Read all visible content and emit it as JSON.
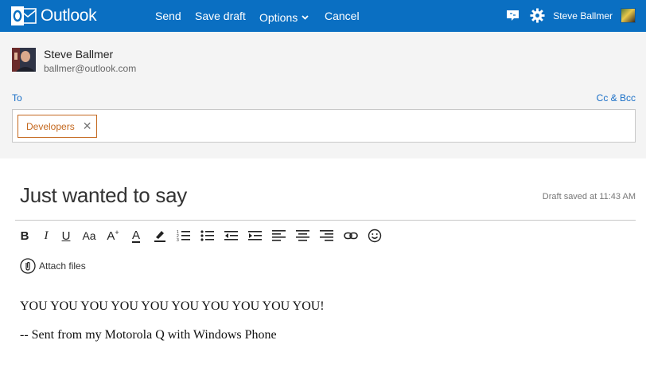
{
  "topbar": {
    "app_name": "Outlook",
    "send_label": "Send",
    "save_draft_label": "Save draft",
    "options_label": "Options",
    "cancel_label": "Cancel",
    "user_name": "Steve Ballmer",
    "icons": [
      "outlook-logo-icon",
      "chat-icon",
      "settings-gear-icon"
    ],
    "bg_color": "#0a6fc2"
  },
  "sender": {
    "name": "Steve Ballmer",
    "email": "ballmer@outlook.com"
  },
  "recipients": {
    "to_label": "To",
    "cc_bcc_label": "Cc & Bcc",
    "chips": [
      {
        "label": "Developers"
      }
    ],
    "chip_color": "#c4681e"
  },
  "compose": {
    "subject": "Just wanted to say",
    "draft_status": "Draft saved at 11:43 AM",
    "toolbar": [
      "bold",
      "italic",
      "underline",
      "font-size",
      "grow-font",
      "font-color",
      "highlight",
      "numbered-list",
      "bulleted-list",
      "decrease-indent",
      "increase-indent",
      "align-left",
      "align-center",
      "align-right",
      "insert-link",
      "emoticon"
    ],
    "toolbar_labels": {
      "bold": "B",
      "italic": "I",
      "underline": "U",
      "font_size": "Aa",
      "grow_font": "A",
      "font_color": "A"
    },
    "attach_label": "Attach files",
    "body_line1": "YOU YOU YOU YOU YOU YOU YOU YOU YOU YOU!",
    "body_line2": "-- Sent from my Motorola Q with Windows Phone"
  }
}
